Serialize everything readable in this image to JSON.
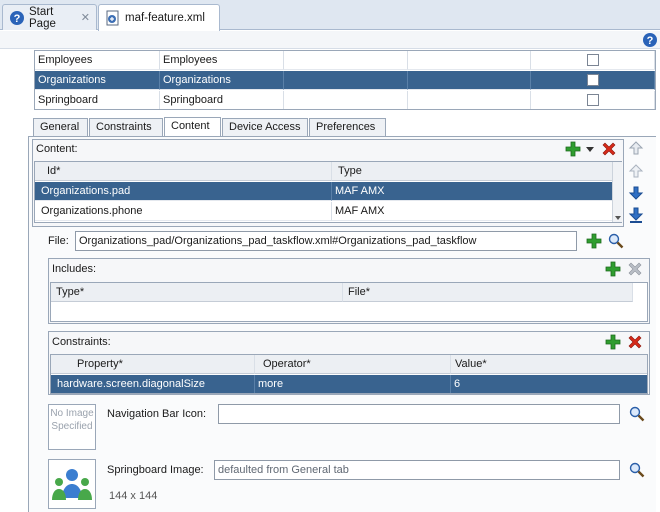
{
  "tabs": [
    {
      "label": "Start Page",
      "icon": "help-icon"
    },
    {
      "label": "maf-feature.xml",
      "icon": "xml-file-icon"
    }
  ],
  "features_table": {
    "rows": [
      {
        "id": "Employees",
        "name": "Employees",
        "checked": false,
        "selected": false
      },
      {
        "id": "Organizations",
        "name": "Organizations",
        "checked": false,
        "selected": true
      },
      {
        "id": "Springboard",
        "name": "Springboard",
        "checked": false,
        "selected": false
      }
    ]
  },
  "subtabs": [
    "General",
    "Constraints",
    "Content",
    "Device Access",
    "Preferences"
  ],
  "active_subtab": "Content",
  "content": {
    "label": "Content:",
    "columns": [
      "Id*",
      "Type"
    ],
    "rows": [
      {
        "id": "Organizations.pad",
        "type": "MAF AMX",
        "selected": true
      },
      {
        "id": "Organizations.phone",
        "type": "MAF AMX",
        "selected": false
      }
    ]
  },
  "file": {
    "label": "File:",
    "value": "Organizations_pad/Organizations_pad_taskflow.xml#Organizations_pad_taskflow"
  },
  "includes": {
    "label": "Includes:",
    "columns": [
      "Type*",
      "File*"
    ]
  },
  "constraints": {
    "label": "Constraints:",
    "columns": [
      "Property*",
      "Operator*",
      "Value*"
    ],
    "rows": [
      {
        "property": "hardware.screen.diagonalSize",
        "operator": "more",
        "value": "6"
      }
    ]
  },
  "nav_icon": {
    "placeholder_text": "No Image Specified",
    "label": "Navigation Bar Icon:",
    "value": ""
  },
  "springboard_image": {
    "label": "Springboard Image:",
    "value": "defaulted from General tab",
    "size": "144 x 144"
  },
  "colors": {
    "selection": "#39638f",
    "add": "#2f9d2f",
    "remove": "#d62a1a",
    "move": "#2f6fc4"
  }
}
